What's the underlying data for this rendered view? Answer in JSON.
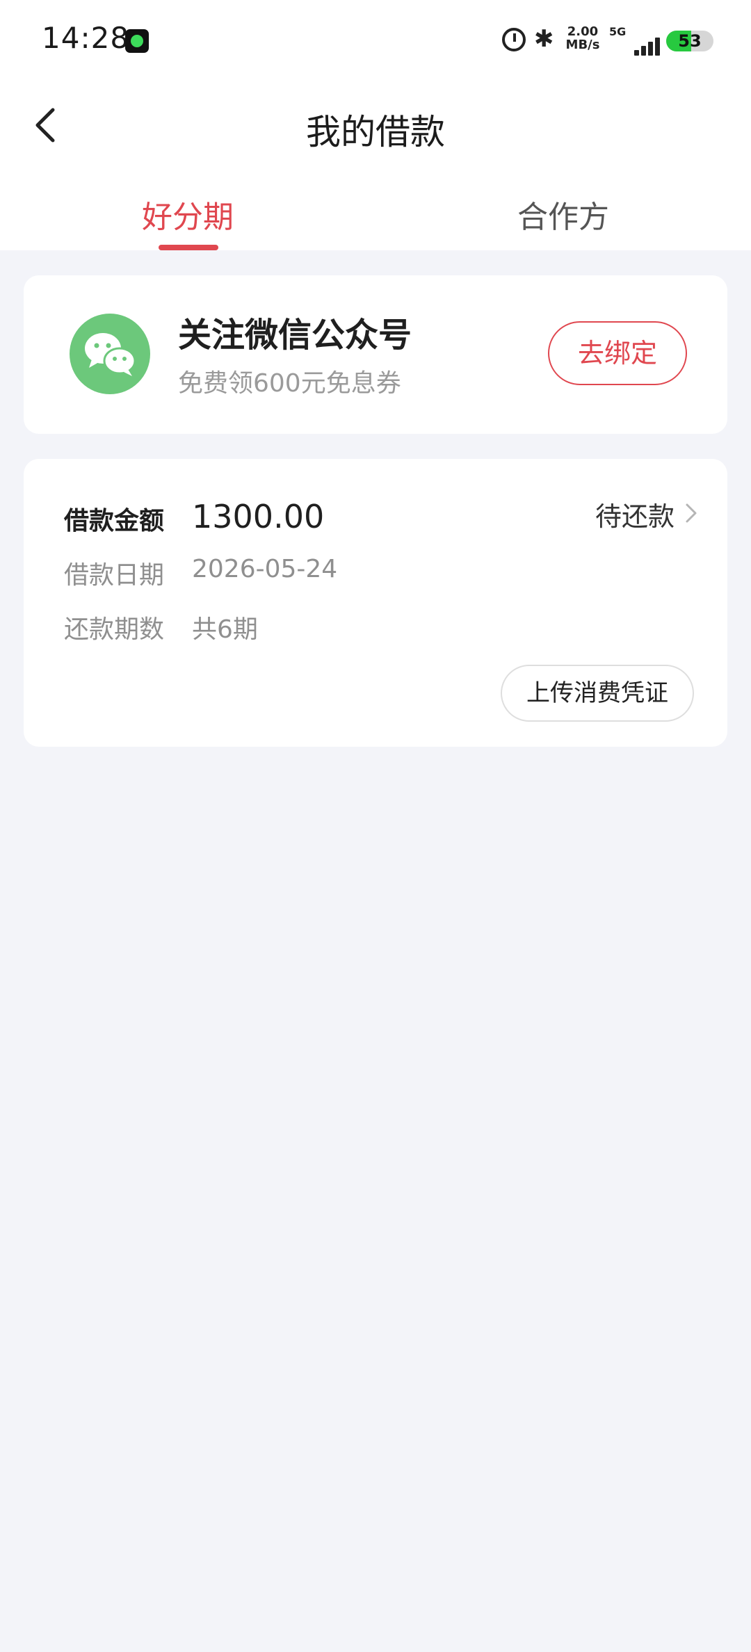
{
  "status_bar": {
    "time": "14:28",
    "net_speed_value": "2.00",
    "net_speed_unit": "MB/s",
    "network_type": "5G",
    "battery_level": "53",
    "battery_fraction": 0.53,
    "app_icon": "music-app-icon",
    "icons": [
      "alarm-icon",
      "bluetooth-icon",
      "signal-icon",
      "battery-icon"
    ]
  },
  "header": {
    "title": "我的借款",
    "back_icon": "chevron-left-icon"
  },
  "tabs": [
    {
      "label": "好分期",
      "active": true
    },
    {
      "label": "合作方",
      "active": false
    }
  ],
  "wechat_card": {
    "icon": "wechat-icon",
    "title": "关注微信公众号",
    "subtitle": "免费领600元免息券",
    "button_label": "去绑定"
  },
  "loan_card": {
    "amount_label": "借款金额",
    "amount_value": "1300.00",
    "status": "待还款",
    "date_label": "借款日期",
    "date_value": "2026-05-24",
    "periods_label": "还款期数",
    "periods_value": "共6期",
    "upload_button_label": "上传消费凭证"
  },
  "colors": {
    "accent": "#e0474f",
    "background": "#f3f4f9",
    "wechat_green": "#6cc87b",
    "battery_green": "#27c93f"
  }
}
